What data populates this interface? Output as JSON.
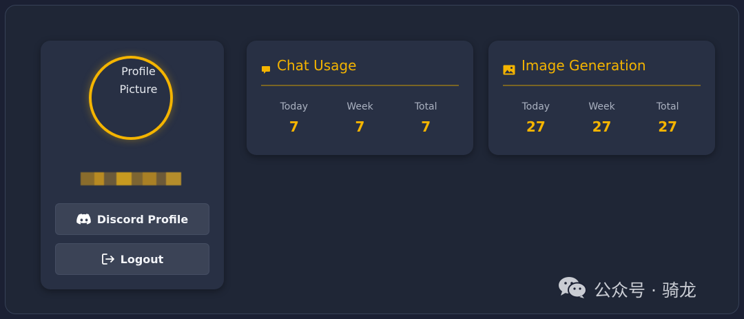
{
  "profile": {
    "avatar_alt": "Profile Picture",
    "discord_button_label": "Discord Profile",
    "logout_button_label": "Logout"
  },
  "stats": {
    "chat": {
      "title": "Chat Usage",
      "icon": "chat-bubble-icon",
      "today_label": "Today",
      "today_value": "7",
      "week_label": "Week",
      "week_value": "7",
      "total_label": "Total",
      "total_value": "7"
    },
    "image": {
      "title": "Image Generation",
      "icon": "image-icon",
      "today_label": "Today",
      "today_value": "27",
      "week_label": "Week",
      "week_value": "27",
      "total_label": "Total",
      "total_value": "27"
    }
  },
  "watermark": {
    "text": "公众号 · 骑龙",
    "icon": "wechat-icon"
  },
  "colors": {
    "accent": "#f4b400",
    "page_background": "#1b2033",
    "panel_background": "#1f2636",
    "card_background": "#283044",
    "button_background": "#3b4356"
  }
}
